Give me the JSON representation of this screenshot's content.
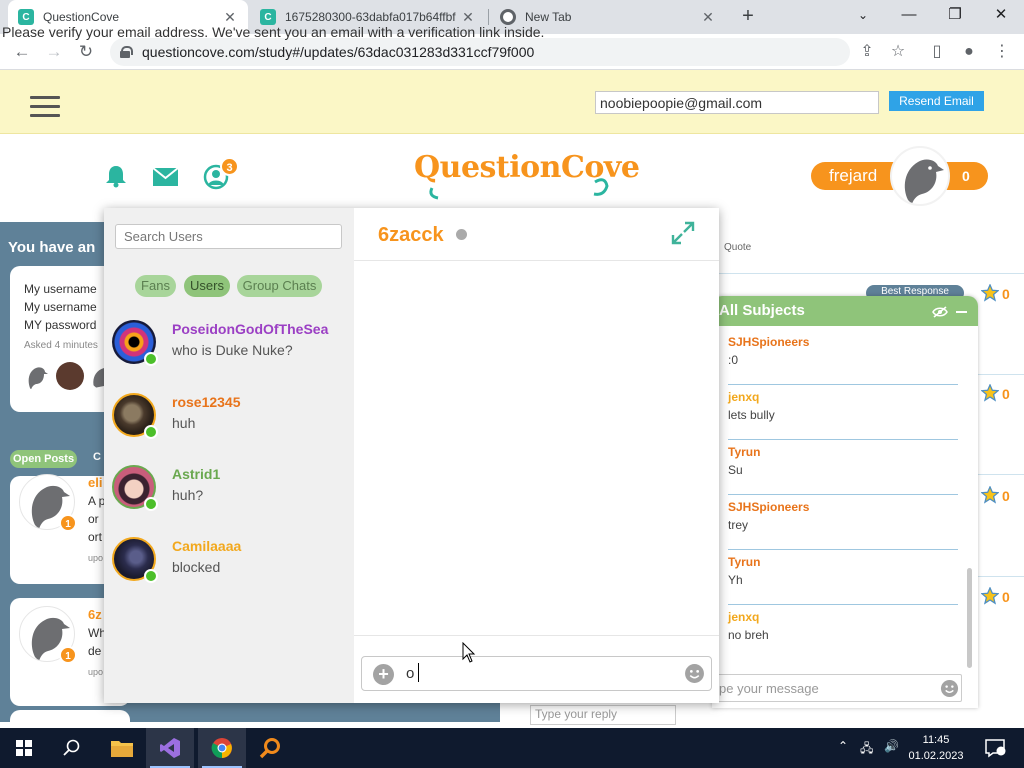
{
  "browser": {
    "tabs": [
      {
        "title": "QuestionCove",
        "active": true
      },
      {
        "title": "1675280300-63dabfa017b64ffbf",
        "active": false
      },
      {
        "title": "New Tab",
        "active": false
      }
    ],
    "url": "questioncove.com/study#/updates/63dac031283d331ccf79f000"
  },
  "verify": {
    "message": "Please verify your email address. We've sent you an email with a verification link inside.",
    "email": "noobiepoopie@gmail.com",
    "resend_label": "Resend Email"
  },
  "header": {
    "logo": "QuestionCove",
    "notification_count": "3",
    "username": "frejard",
    "score": "0"
  },
  "feed": {
    "heading": "You have an",
    "card_lines": [
      "My username",
      "My username",
      "MY password"
    ],
    "asked": "Asked 4 minutes",
    "tabs": [
      "Open Posts",
      "C"
    ],
    "posts": [
      {
        "author": "eli",
        "lines": [
          "A p",
          "or",
          "ort"
        ],
        "meta": "upo",
        "badge": "1"
      },
      {
        "author": "6z",
        "lines": [
          "Wh",
          "de"
        ],
        "meta": "upo",
        "badge": "1"
      }
    ],
    "quote_label": "Quote",
    "best_response": "Best Response",
    "star_counts": [
      "0",
      "0",
      "0",
      "0"
    ],
    "reply_placeholder": "Type your reply"
  },
  "subjects_chat": {
    "title": "All Subjects",
    "messages": [
      {
        "user": "SJHSpioneers",
        "text": ":0",
        "color": "#e8741b"
      },
      {
        "user": "jenxq",
        "text": "lets bully",
        "color": "#f2a81d"
      },
      {
        "user": "Tyrun",
        "text": "Su",
        "color": "#e8741b"
      },
      {
        "user": "SJHSpioneers",
        "text": "trey",
        "color": "#e8741b"
      },
      {
        "user": "Tyrun",
        "text": "Yh",
        "color": "#e8741b"
      },
      {
        "user": "jenxq",
        "text": "no breh",
        "color": "#f2a81d"
      }
    ],
    "input_placeholder": "pe your message"
  },
  "dm": {
    "search_placeholder": "Search Users",
    "filters": [
      "Fans",
      "Users",
      "Group Chats"
    ],
    "selected_filter": "Users",
    "contacts": [
      {
        "name": "PoseidonGodOfTheSea",
        "last": "who is Duke Nuke?",
        "color": "#9b3fc4"
      },
      {
        "name": "rose12345",
        "last": "huh",
        "color": "#e8741b"
      },
      {
        "name": "Astrid1",
        "last": "huh?",
        "color": "#6aa84f"
      },
      {
        "name": "Camilaaaa",
        "last": "blocked",
        "color": "#f2a81d"
      }
    ],
    "peer": "6zacck",
    "typed": "o"
  },
  "taskbar": {
    "time": "11:45",
    "date": "01.02.2023"
  },
  "colors": {
    "brand_orange": "#f7941d",
    "green": "#8fc47a",
    "steel": "#5f8198",
    "online": "#4cbf2a"
  }
}
